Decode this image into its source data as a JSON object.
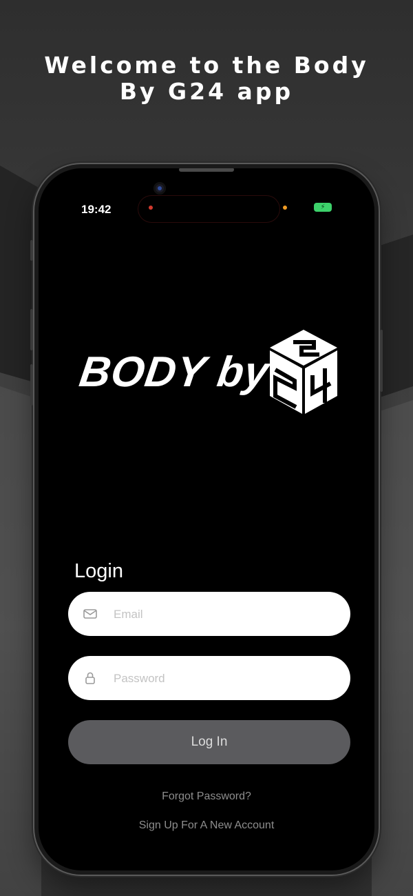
{
  "promo": {
    "title_line1": "Welcome to the Body",
    "title_line2": "By G24 app"
  },
  "status_bar": {
    "time": "19:42",
    "battery_icon": "charging-battery-icon",
    "battery_color": "#3dd16b"
  },
  "logo": {
    "text": "BODY by",
    "icon": "g24-cube-logo-icon",
    "mark_text": "G24"
  },
  "login": {
    "title": "Login",
    "email_placeholder": "Email",
    "email_value": "",
    "email_icon": "mail-icon",
    "password_placeholder": "Password",
    "password_value": "",
    "password_icon": "lock-icon",
    "submit_label": "Log In",
    "forgot_password": "Forgot Password?",
    "sign_up": "Sign Up For A New Account"
  },
  "colors": {
    "screen_bg": "#000000",
    "field_bg": "#ffffff",
    "button_bg": "#5b5b5e",
    "link_text": "#8e8e8e"
  }
}
